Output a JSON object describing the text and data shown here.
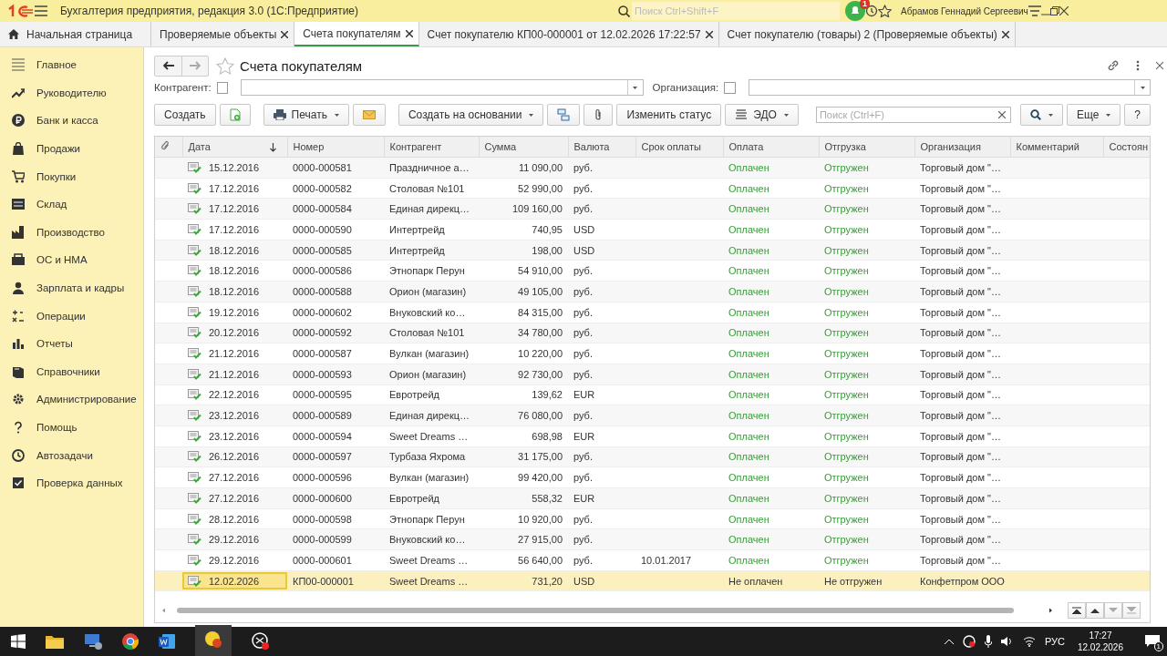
{
  "app": {
    "title": "Бухгалтерия предприятия, редакция 3.0  (1С:Предприятие)",
    "search_placeholder": "Поиск Ctrl+Shift+F",
    "notifications": "1",
    "user": "Абрамов Геннадий Сергеевич"
  },
  "tabs": [
    {
      "kind": "home",
      "label": "Начальная страница",
      "selected": false
    },
    {
      "kind": "doc",
      "label": "Проверяемые объекты",
      "selected": false
    },
    {
      "kind": "doc",
      "label": "Счета покупателям",
      "selected": true
    },
    {
      "kind": "doc",
      "label": "Счет покупателю КП00-000001 от 12.02.2026 17:22:57",
      "selected": false
    },
    {
      "kind": "doc",
      "label": "Счет покупателю (товары) 2 (Проверяемые объекты)",
      "selected": false
    }
  ],
  "sidebar": {
    "items": [
      {
        "label": "Главное"
      },
      {
        "label": "Руководителю"
      },
      {
        "label": "Банк и касса"
      },
      {
        "label": "Продажи"
      },
      {
        "label": "Покупки"
      },
      {
        "label": "Склад"
      },
      {
        "label": "Производство"
      },
      {
        "label": "ОС и НМА"
      },
      {
        "label": "Зарплата и кадры"
      },
      {
        "label": "Операции"
      },
      {
        "label": "Отчеты"
      },
      {
        "label": "Справочники"
      },
      {
        "label": "Администрирование"
      },
      {
        "label": "Помощь"
      },
      {
        "label": "Автозадачи"
      },
      {
        "label": "Проверка данных"
      }
    ]
  },
  "form": {
    "title": "Счета покупателям",
    "filters": [
      {
        "label": "Контрагент:",
        "checked": false
      },
      {
        "label": "Организация:",
        "checked": false
      }
    ],
    "toolbar": {
      "create": "Создать",
      "print": "Печать",
      "base": "Создать на основании",
      "status": "Изменить статус",
      "edo": "ЭДО",
      "search_placeholder": "Поиск (Ctrl+F)",
      "more": "Еще",
      "help": "?"
    }
  },
  "table": {
    "columns": [
      {
        "label": "Дата",
        "sorted": true
      },
      {
        "label": "Номер"
      },
      {
        "label": "Контрагент"
      },
      {
        "label": "Сумма"
      },
      {
        "label": "Валюта"
      },
      {
        "label": "Срок оплаты"
      },
      {
        "label": "Оплата"
      },
      {
        "label": "Отгрузка"
      },
      {
        "label": "Организация"
      },
      {
        "label": "Комментарий"
      },
      {
        "label": "Состоян"
      }
    ],
    "rows": [
      {
        "date": "15.12.2016",
        "number": "0000-000581",
        "counterparty": "Праздничное а…",
        "sum": "11 090,00",
        "currency": "руб.",
        "payment": "Оплачен",
        "paid": true,
        "shipment": "Отгружен",
        "shipped": true,
        "organization": "Торговый дом \"…",
        "selected": false
      },
      {
        "date": "17.12.2016",
        "number": "0000-000582",
        "counterparty": "Столовая №101",
        "sum": "52 990,00",
        "currency": "руб.",
        "payment": "Оплачен",
        "paid": true,
        "shipment": "Отгружен",
        "shipped": true,
        "organization": "Торговый дом \"…",
        "selected": false
      },
      {
        "date": "17.12.2016",
        "number": "0000-000584",
        "counterparty": "Единая дирекц…",
        "sum": "109 160,00",
        "currency": "руб.",
        "payment": "Оплачен",
        "paid": true,
        "shipment": "Отгружен",
        "shipped": true,
        "organization": "Торговый дом \"…",
        "selected": false
      },
      {
        "date": "17.12.2016",
        "number": "0000-000590",
        "counterparty": "Интертрейд",
        "sum": "740,95",
        "currency": "USD",
        "payment": "Оплачен",
        "paid": true,
        "shipment": "Отгружен",
        "shipped": true,
        "organization": "Торговый дом \"…",
        "selected": false
      },
      {
        "date": "18.12.2016",
        "number": "0000-000585",
        "counterparty": "Интертрейд",
        "sum": "198,00",
        "currency": "USD",
        "payment": "Оплачен",
        "paid": true,
        "shipment": "Отгружен",
        "shipped": true,
        "organization": "Торговый дом \"…",
        "selected": false
      },
      {
        "date": "18.12.2016",
        "number": "0000-000586",
        "counterparty": "Этнопарк Перун",
        "sum": "54 910,00",
        "currency": "руб.",
        "payment": "Оплачен",
        "paid": true,
        "shipment": "Отгружен",
        "shipped": true,
        "organization": "Торговый дом \"…",
        "selected": false
      },
      {
        "date": "18.12.2016",
        "number": "0000-000588",
        "counterparty": "Орион (магазин)",
        "sum": "49 105,00",
        "currency": "руб.",
        "payment": "Оплачен",
        "paid": true,
        "shipment": "Отгружен",
        "shipped": true,
        "organization": "Торговый дом \"…",
        "selected": false
      },
      {
        "date": "19.12.2016",
        "number": "0000-000602",
        "counterparty": "Внуковский ко…",
        "sum": "84 315,00",
        "currency": "руб.",
        "payment": "Оплачен",
        "paid": true,
        "shipment": "Отгружен",
        "shipped": true,
        "organization": "Торговый дом \"…",
        "selected": false
      },
      {
        "date": "20.12.2016",
        "number": "0000-000592",
        "counterparty": "Столовая №101",
        "sum": "34 780,00",
        "currency": "руб.",
        "payment": "Оплачен",
        "paid": true,
        "shipment": "Отгружен",
        "shipped": true,
        "organization": "Торговый дом \"…",
        "selected": false
      },
      {
        "date": "21.12.2016",
        "number": "0000-000587",
        "counterparty": "Вулкан (магазин)",
        "sum": "10 220,00",
        "currency": "руб.",
        "payment": "Оплачен",
        "paid": true,
        "shipment": "Отгружен",
        "shipped": true,
        "organization": "Торговый дом \"…",
        "selected": false
      },
      {
        "date": "21.12.2016",
        "number": "0000-000593",
        "counterparty": "Орион (магазин)",
        "sum": "92 730,00",
        "currency": "руб.",
        "payment": "Оплачен",
        "paid": true,
        "shipment": "Отгружен",
        "shipped": true,
        "organization": "Торговый дом \"…",
        "selected": false
      },
      {
        "date": "22.12.2016",
        "number": "0000-000595",
        "counterparty": "Евротрейд",
        "sum": "139,62",
        "currency": "EUR",
        "payment": "Оплачен",
        "paid": true,
        "shipment": "Отгружен",
        "shipped": true,
        "organization": "Торговый дом \"…",
        "selected": false
      },
      {
        "date": "23.12.2016",
        "number": "0000-000589",
        "counterparty": "Единая дирекц…",
        "sum": "76 080,00",
        "currency": "руб.",
        "payment": "Оплачен",
        "paid": true,
        "shipment": "Отгружен",
        "shipped": true,
        "organization": "Торговый дом \"…",
        "selected": false
      },
      {
        "date": "23.12.2016",
        "number": "0000-000594",
        "counterparty": "Sweet Dreams …",
        "sum": "698,98",
        "currency": "EUR",
        "payment": "Оплачен",
        "paid": true,
        "shipment": "Отгружен",
        "shipped": true,
        "organization": "Торговый дом \"…",
        "selected": false
      },
      {
        "date": "26.12.2016",
        "number": "0000-000597",
        "counterparty": "Турбаза Яхрома",
        "sum": "31 175,00",
        "currency": "руб.",
        "payment": "Оплачен",
        "paid": true,
        "shipment": "Отгружен",
        "shipped": true,
        "organization": "Торговый дом \"…",
        "selected": false
      },
      {
        "date": "27.12.2016",
        "number": "0000-000596",
        "counterparty": "Вулкан (магазин)",
        "sum": "99 420,00",
        "currency": "руб.",
        "payment": "Оплачен",
        "paid": true,
        "shipment": "Отгружен",
        "shipped": true,
        "organization": "Торговый дом \"…",
        "selected": false
      },
      {
        "date": "27.12.2016",
        "number": "0000-000600",
        "counterparty": "Евротрейд",
        "sum": "558,32",
        "currency": "EUR",
        "payment": "Оплачен",
        "paid": true,
        "shipment": "Отгружен",
        "shipped": true,
        "organization": "Торговый дом \"…",
        "selected": false
      },
      {
        "date": "28.12.2016",
        "number": "0000-000598",
        "counterparty": "Этнопарк Перун",
        "sum": "10 920,00",
        "currency": "руб.",
        "payment": "Оплачен",
        "paid": true,
        "shipment": "Отгружен",
        "shipped": true,
        "organization": "Торговый дом \"…",
        "selected": false
      },
      {
        "date": "29.12.2016",
        "number": "0000-000599",
        "counterparty": "Внуковский ко…",
        "sum": "27 915,00",
        "currency": "руб.",
        "payment": "Оплачен",
        "paid": true,
        "shipment": "Отгружен",
        "shipped": true,
        "organization": "Торговый дом \"…",
        "selected": false
      },
      {
        "date": "29.12.2016",
        "number": "0000-000601",
        "counterparty": "Sweet Dreams …",
        "sum": "56 640,00",
        "currency": "руб.",
        "due": "10.01.2017",
        "payment": "Оплачен",
        "paid": true,
        "shipment": "Отгружен",
        "shipped": true,
        "organization": "Торговый дом \"…",
        "selected": false
      },
      {
        "date": "12.02.2026",
        "number": "КП00-000001",
        "counterparty": "Sweet Dreams …",
        "sum": "731,20",
        "currency": "USD",
        "payment": "Не оплачен",
        "paid": false,
        "shipment": "Не отгружен",
        "shipped": false,
        "organization": "Конфетпром ООО",
        "selected": true
      }
    ]
  },
  "taskbar": {
    "language": "РУС",
    "time": "17:27",
    "date": "12.02.2026",
    "notifications": "1"
  }
}
